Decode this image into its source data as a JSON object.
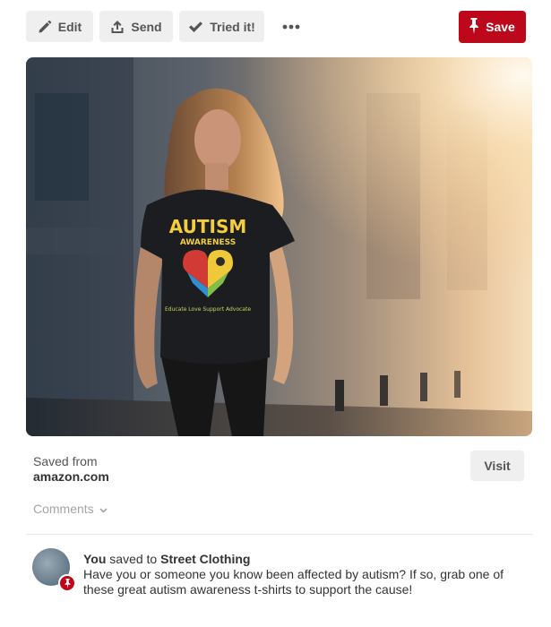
{
  "toolbar": {
    "edit_label": "Edit",
    "send_label": "Send",
    "tried_label": "Tried it!",
    "save_label": "Save",
    "icons": {
      "edit": "pencil-icon",
      "send": "share-upload-icon",
      "tried": "checkmark-icon",
      "more": "more-dots-icon",
      "save": "pushpin-icon"
    }
  },
  "pin": {
    "image_text": {
      "line1": "AUTISM",
      "line2": "AWARENESS",
      "tagline": "Educate  Love  Support  Advocate"
    },
    "saved_from_label": "Saved from",
    "source_domain": "amazon.com",
    "visit_label": "Visit"
  },
  "comments": {
    "label": "Comments"
  },
  "activity": {
    "user": "You",
    "verb": " saved to ",
    "board": "Street Clothing",
    "description": "Have you or someone you know been affected by autism? If so, grab one of these great autism awareness t-shirts to support the cause!"
  },
  "colors": {
    "brand_red": "#bd081c",
    "button_gray": "#efefef",
    "muted_text": "#a5a5a5"
  }
}
